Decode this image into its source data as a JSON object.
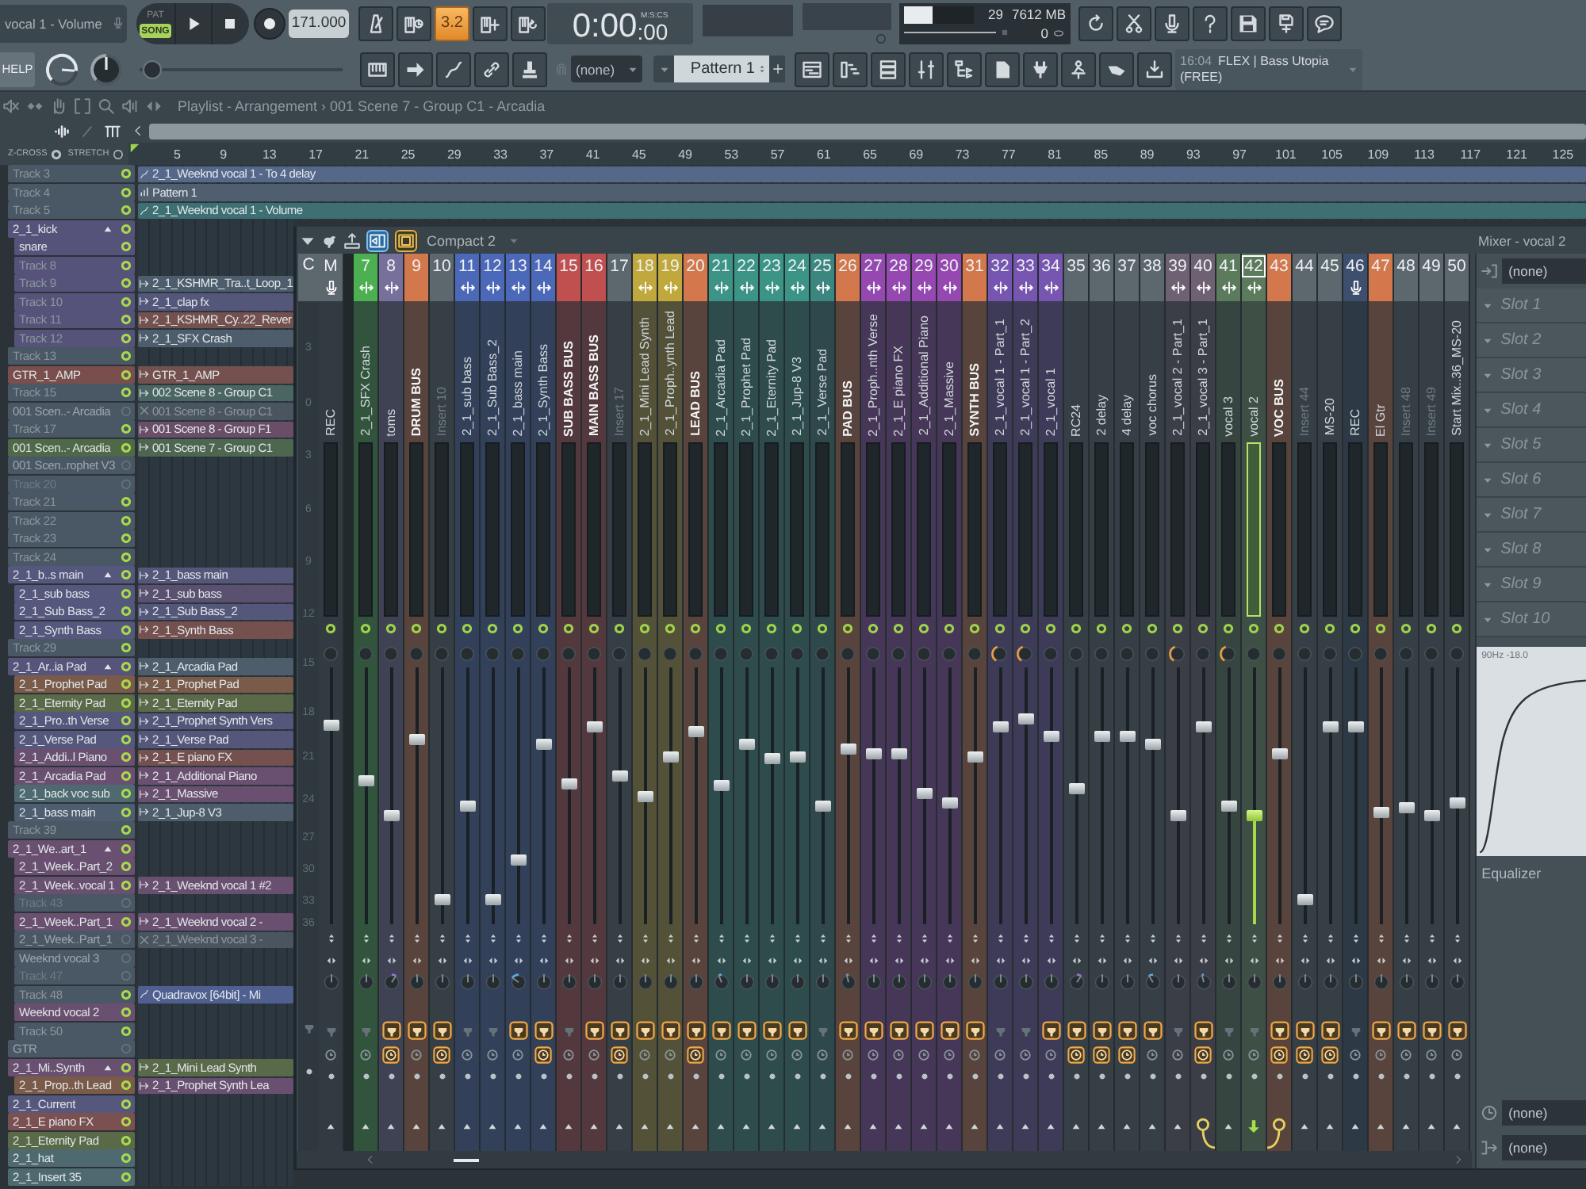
{
  "toolbar": {
    "hint": "vocal 1 - Volume",
    "modes": [
      {
        "label": "PAT",
        "selected": false
      },
      {
        "label": "SONG",
        "selected": true
      }
    ],
    "tempo": "171.000",
    "countdown": {
      "label": "3.2",
      "on": true
    },
    "time": {
      "main": "0:00",
      "fraction": ":00",
      "unit": "M:S:CS"
    },
    "cpu": {
      "level": 0.4,
      "reading": "29"
    },
    "memory": "7612 MB",
    "polyphony": "0",
    "help": "HELP",
    "knobs": [
      {
        "level": 0.85
      },
      {
        "level": 0.5
      }
    ],
    "slider": {
      "level": 0.02
    },
    "snap": "(none)",
    "pattern": "Pattern 1",
    "news": {
      "time": "16:04",
      "title": "FLEX | Bass Utopia",
      "note": "(FREE)"
    }
  },
  "playlist": {
    "title": "Playlist - Arrangement › 001 Scene 7 - Group C1 - Arcadia",
    "options": [
      {
        "label": "Z-CROSS",
        "on": true
      },
      {
        "label": "STRETCH",
        "on": false
      }
    ],
    "ruler": [
      "5",
      "9",
      "13",
      "17",
      "21",
      "25",
      "29",
      "33",
      "37",
      "41",
      "45",
      "49",
      "53",
      "57",
      "61",
      "65",
      "69",
      "73",
      "77",
      "81",
      "85",
      "89",
      "93",
      "97",
      "101",
      "105",
      "109",
      "113",
      "117",
      "121",
      "125"
    ],
    "tracks": [
      {
        "name": "Track 3",
        "color": "#4a5764",
        "default_name": true,
        "enabled": true,
        "clip": {
          "label": "2_1_Weeknd vocal 1 - To 4 delay",
          "kind": "automation",
          "color": "#56688a",
          "muted": false
        }
      },
      {
        "name": "Track 4",
        "color": "#4a5764",
        "default_name": true,
        "enabled": true,
        "clip": {
          "label": "Pattern 1",
          "kind": "pattern",
          "color": "#505f70",
          "muted": false
        }
      },
      {
        "name": "Track 5",
        "color": "#4a5764",
        "default_name": true,
        "enabled": true,
        "clip": {
          "label": "2_1_Weeknd vocal 1 - Volume",
          "kind": "automation",
          "color": "#3d6f73",
          "muted": false
        }
      },
      {
        "name": "2_1_kick",
        "color": "#56537a",
        "default_name": false,
        "enabled": true,
        "expanded": true,
        "children": [
          {
            "name": "snare",
            "color": "#56537a",
            "default_name": false,
            "enabled": true
          },
          {
            "name": "Track 8",
            "color": "#56537a",
            "default_name": true,
            "enabled": true
          },
          {
            "name": "Track 9",
            "color": "#56537a",
            "default_name": true,
            "enabled": true,
            "clip": {
              "label": "2_1_KSHMR_Tra..t_Loop_1",
              "kind": "audio",
              "color": "#4d5d6c",
              "muted": false
            }
          },
          {
            "name": "Track 10",
            "color": "#56537a",
            "default_name": true,
            "enabled": true,
            "clip": {
              "label": "2_1_clap fx",
              "kind": "audio",
              "color": "#55577a",
              "muted": false
            }
          },
          {
            "name": "Track 11",
            "color": "#56537a",
            "default_name": true,
            "enabled": true,
            "clip": {
              "label": "2_1_KSHMR_Cy..22_Rever",
              "kind": "audio",
              "color": "#74504e",
              "muted": false
            }
          },
          {
            "name": "Track 12",
            "color": "#56537a",
            "default_name": true,
            "enabled": true,
            "clip": {
              "label": "2_1_SFX Crash",
              "kind": "audio",
              "color": "#4d5d6c",
              "muted": false
            }
          }
        ]
      },
      {
        "name": "Track 13",
        "color": "#4a5764",
        "default_name": true,
        "enabled": true
      },
      {
        "name": "GTR_1_AMP",
        "color": "#7a4e4c",
        "default_name": false,
        "enabled": true,
        "clip": {
          "label": "GTR_1_AMP",
          "kind": "audio",
          "color": "#74504e",
          "muted": false
        }
      },
      {
        "name": "Track 15",
        "color": "#4a5764",
        "default_name": true,
        "enabled": true,
        "clip": {
          "label": "002 Scene 8 - Group C1",
          "kind": "audio",
          "color": "#4b6662",
          "muted": false
        }
      },
      {
        "name": "001 Scen..- Arcadia",
        "color": "#4a5764",
        "default_name": false,
        "enabled": false,
        "clip": {
          "label": "001 Scene 8 - Group C1",
          "color": "#4a5560",
          "muted": true
        }
      },
      {
        "name": "Track 17",
        "color": "#4a5764",
        "default_name": true,
        "enabled": true,
        "clip": {
          "label": "001 Scene 8 - Group F1",
          "kind": "audio",
          "color": "#6a4e68",
          "muted": false
        }
      },
      {
        "name": "001 Scen..- Arcadia",
        "color": "#4e6848",
        "default_name": false,
        "enabled": true,
        "clip": {
          "label": "001 Scene 7 - Group C1",
          "kind": "audio",
          "color": "#4e6650",
          "muted": false
        }
      },
      {
        "name": "001 Scen..rophet V3",
        "color": "#4a5764",
        "default_name": false,
        "enabled": false
      },
      {
        "name": "Track 20",
        "color": "#4a5764",
        "default_name": true,
        "enabled": false
      },
      {
        "name": "Track 21",
        "color": "#4a5764",
        "default_name": true,
        "enabled": true
      },
      {
        "name": "Track 22",
        "color": "#4a5764",
        "default_name": true,
        "enabled": true
      },
      {
        "name": "Track 23",
        "color": "#4a5764",
        "default_name": true,
        "enabled": true
      },
      {
        "name": "Track 24",
        "color": "#4a5764",
        "default_name": true,
        "enabled": true
      },
      {
        "name": "2_1_b..s main",
        "color": "#55577d",
        "default_name": false,
        "enabled": true,
        "expanded": true,
        "clip": {
          "label": "2_1_bass main",
          "kind": "audio",
          "color": "#55577a",
          "muted": false
        },
        "children": [
          {
            "name": "2_1_sub bass",
            "color": "#55577d",
            "default_name": false,
            "enabled": true,
            "clip": {
              "label": "2_1_sub bass",
              "kind": "audio",
              "color": "#5a5070",
              "muted": false
            }
          },
          {
            "name": "2_1_Sub Bass_2",
            "color": "#55577d",
            "default_name": false,
            "enabled": true,
            "clip": {
              "label": "2_1_Sub Bass_2",
              "kind": "audio",
              "color": "#55577a",
              "muted": false
            }
          },
          {
            "name": "2_1_Synth Bass",
            "color": "#55577d",
            "default_name": false,
            "enabled": true,
            "clip": {
              "label": "2_1_Synth Bass",
              "kind": "audio",
              "color": "#74504e",
              "muted": false
            }
          }
        ]
      },
      {
        "name": "Track 29",
        "color": "#4a5764",
        "default_name": true,
        "enabled": true
      },
      {
        "name": "2_1_Ar..ia Pad",
        "color": "#56547a",
        "default_name": false,
        "enabled": true,
        "expanded": true,
        "clip": {
          "label": "2_1_Arcadia Pad",
          "kind": "audio",
          "color": "#4d5d6c",
          "muted": false
        },
        "children": [
          {
            "name": "2_1_Prophet Pad",
            "color": "#7a5a48",
            "default_name": false,
            "enabled": true,
            "clip": {
              "label": "2_1_Prophet Pad",
              "kind": "audio",
              "color": "#7a5a48",
              "muted": false
            }
          },
          {
            "name": "2_1_Eternity Pad",
            "color": "#5a6a48",
            "default_name": false,
            "enabled": true,
            "clip": {
              "label": "2_1_Eternity Pad",
              "kind": "audio",
              "color": "#5a6a48",
              "muted": false
            }
          },
          {
            "name": "2_1_Pro..th Verse",
            "color": "#55577d",
            "default_name": false,
            "enabled": true,
            "clip": {
              "label": "2_1_Prophet Synth Vers",
              "kind": "audio",
              "color": "#55577a",
              "muted": false
            }
          },
          {
            "name": "2_1_Verse Pad",
            "color": "#55577d",
            "default_name": false,
            "enabled": true,
            "clip": {
              "label": "2_1_Verse Pad",
              "kind": "audio",
              "color": "#55577a",
              "muted": false
            }
          },
          {
            "name": "2_1_Addi..l Piano",
            "color": "#6a5070",
            "default_name": false,
            "enabled": true,
            "clip": {
              "label": "2_1_E piano FX",
              "kind": "audio",
              "color": "#74504e",
              "muted": false
            }
          },
          {
            "name": "2_1_Arcadia Pad",
            "color": "#6a5070",
            "default_name": false,
            "enabled": true,
            "clip": {
              "label": "2_1_Additional Piano",
              "kind": "audio",
              "color": "#6a5070",
              "muted": false
            }
          },
          {
            "name": "2_1_back voc sub",
            "color": "#4e6a70",
            "default_name": false,
            "enabled": true,
            "clip": {
              "label": "2_1_Massive",
              "kind": "audio",
              "color": "#6a5070",
              "muted": false
            }
          },
          {
            "name": "2_1_bass main",
            "color": "#4e5e70",
            "default_name": false,
            "enabled": true,
            "clip": {
              "label": "2_1_Jup-8 V3",
              "kind": "audio",
              "color": "#4d5d6c",
              "muted": false
            }
          }
        ]
      },
      {
        "name": "Track 39",
        "color": "#4a5764",
        "default_name": true,
        "enabled": true
      },
      {
        "name": "2_1_We..art_1",
        "color": "#6a5070",
        "default_name": false,
        "enabled": true,
        "expanded": true,
        "children": [
          {
            "name": "2_1_Week..Part_2",
            "color": "#6a5070",
            "default_name": false,
            "enabled": true
          },
          {
            "name": "2_1_Week..vocal 1",
            "color": "#6a5070",
            "default_name": false,
            "enabled": true,
            "clip": {
              "label": "2_1_Weeknd vocal 1 #2",
              "kind": "audio",
              "color": "#6a5070",
              "muted": false
            }
          },
          {
            "name": "Track 43",
            "color": "#4a5764",
            "default_name": true,
            "enabled": false
          },
          {
            "name": "2_1_Week..Part_1",
            "color": "#6a5070",
            "default_name": false,
            "enabled": true,
            "clip": {
              "label": "2_1_Weeknd vocal 2 -",
              "kind": "audio",
              "color": "#6a5070",
              "muted": false
            }
          },
          {
            "name": "2_1_Week..Part_1",
            "color": "#4a5764",
            "default_name": false,
            "enabled": false,
            "clip": {
              "label": "2_1_Weeknd vocal 3 -",
              "color": "#4a5560",
              "muted": true
            }
          },
          {
            "name": "Weeknd vocal 3",
            "color": "#4a5764",
            "default_name": false,
            "enabled": false
          },
          {
            "name": "Track 47",
            "color": "#4a5764",
            "default_name": true,
            "enabled": false
          },
          {
            "name": "Track 48",
            "color": "#4a5764",
            "default_name": true,
            "enabled": true,
            "clip": {
              "label": "Quadravox [64bit] - Mi",
              "kind": "automation",
              "color": "#4f6090",
              "muted": false
            }
          },
          {
            "name": "Weeknd vocal 2",
            "color": "#6a5070",
            "default_name": false,
            "enabled": true
          },
          {
            "name": "Track 50",
            "color": "#4a5764",
            "default_name": true,
            "enabled": true
          }
        ]
      },
      {
        "name": "GTR",
        "color": "#4a5764",
        "default_name": false,
        "enabled": false
      },
      {
        "name": "2_1_Mi..Synth",
        "color": "#6a5070",
        "default_name": false,
        "enabled": true,
        "expanded": true,
        "clip": {
          "label": "2_1_Mini Lead Synth",
          "kind": "audio",
          "color": "#5a6a48",
          "muted": false
        },
        "children": [
          {
            "name": "2_1_Prop..th Lead",
            "color": "#7a5a48",
            "default_name": false,
            "enabled": true,
            "clip": {
              "label": "2_1_Prophet Synth Lea",
              "kind": "audio",
              "color": "#6a5070",
              "muted": false
            }
          }
        ]
      },
      {
        "name": "2_1_Current",
        "color": "#55577d",
        "default_name": false,
        "enabled": true
      },
      {
        "name": "2_1_E piano FX",
        "color": "#7a5050",
        "default_name": false,
        "enabled": true
      },
      {
        "name": "2_1_Eternity Pad",
        "color": "#5a6a48",
        "default_name": false,
        "enabled": true
      },
      {
        "name": "2_1_hat",
        "color": "#4e6a70",
        "default_name": false,
        "enabled": true
      },
      {
        "name": "2_1_Insert 35",
        "color": "#4e6a70",
        "default_name": false,
        "enabled": true
      }
    ]
  },
  "mixer": {
    "title": "Mixer - vocal 2",
    "layout": "Compact 2",
    "current": {
      "label": "C",
      "scale": [
        "3",
        "0",
        "3",
        "6",
        "9",
        "12",
        "15",
        "18",
        "21",
        "24",
        "27",
        "30",
        "33",
        "36"
      ]
    },
    "master": {
      "label": "M",
      "name": "REC",
      "recording": true,
      "level": 0.79,
      "pan": {
        "level": 0.5
      },
      "fx_loaded": false,
      "fx_enabled": false
    },
    "inserts": [
      {
        "number": "7",
        "name": "2_1_SFX Crash",
        "color": "#4caf50",
        "kind": "channel",
        "linked": true,
        "recording": false,
        "level": 0.56,
        "pan": {
          "level": 0.5
        },
        "send": false,
        "fx_loaded": false,
        "fx_enabled": false,
        "selected": false,
        "sends_to_selected": false
      },
      {
        "number": "8",
        "name": "toms",
        "color": "#76709a",
        "kind": "channel",
        "linked": true,
        "recording": false,
        "level": 0.42,
        "pan": {
          "level": 0.62
        },
        "send": false,
        "fx_loaded": true,
        "fx_enabled": true,
        "selected": false,
        "sends_to_selected": false
      },
      {
        "number": "9",
        "name": "DRUM BUS",
        "color": "#d2784c",
        "kind": "bus",
        "linked": false,
        "recording": false,
        "level": 0.73,
        "pan": {
          "level": 0.5
        },
        "send": false,
        "fx_loaded": true,
        "fx_enabled": false,
        "selected": false,
        "sends_to_selected": false
      },
      {
        "number": "10",
        "name": "Insert 10",
        "color": "#5d676e",
        "kind": "empty",
        "linked": false,
        "recording": false,
        "level": 0.08,
        "pan": {
          "level": 0.5
        },
        "send": false,
        "fx_loaded": true,
        "fx_enabled": true,
        "selected": false,
        "sends_to_selected": false
      },
      {
        "number": "11",
        "name": "2_1_sub bass",
        "color": "#4c68b8",
        "kind": "channel",
        "linked": true,
        "recording": false,
        "level": 0.46,
        "pan": {
          "level": 0.5
        },
        "send": false,
        "fx_loaded": false,
        "fx_enabled": false,
        "selected": false,
        "sends_to_selected": false
      },
      {
        "number": "12",
        "name": "2_1_Sub Bass_2",
        "color": "#4c68b8",
        "kind": "channel",
        "linked": true,
        "recording": false,
        "level": 0.08,
        "pan": {
          "level": 0.5
        },
        "send": false,
        "fx_loaded": false,
        "fx_enabled": false,
        "selected": false,
        "sends_to_selected": false
      },
      {
        "number": "13",
        "name": "2_1_bass main",
        "color": "#4c68b8",
        "kind": "channel",
        "linked": true,
        "recording": false,
        "level": 0.24,
        "pan": {
          "level": 0.3
        },
        "send": false,
        "fx_loaded": true,
        "fx_enabled": false,
        "selected": false,
        "sends_to_selected": false
      },
      {
        "number": "14",
        "name": "2_1_Synth Bass",
        "color": "#4c68b8",
        "kind": "channel",
        "linked": true,
        "recording": false,
        "level": 0.71,
        "pan": {
          "level": 0.5
        },
        "send": false,
        "fx_loaded": true,
        "fx_enabled": true,
        "selected": false,
        "sends_to_selected": false
      },
      {
        "number": "15",
        "name": "SUB BASS BUS",
        "color": "#c05050",
        "kind": "bus",
        "linked": false,
        "recording": false,
        "level": 0.55,
        "pan": {
          "level": 0.5
        },
        "send": false,
        "fx_loaded": false,
        "fx_enabled": false,
        "selected": false,
        "sends_to_selected": false
      },
      {
        "number": "16",
        "name": "MAIN BASS BUS",
        "color": "#c05050",
        "kind": "bus",
        "linked": false,
        "recording": false,
        "level": 0.78,
        "pan": {
          "level": 0.5
        },
        "send": false,
        "fx_loaded": true,
        "fx_enabled": false,
        "selected": false,
        "sends_to_selected": false
      },
      {
        "number": "17",
        "name": "Insert 17",
        "color": "#5d676e",
        "kind": "empty",
        "linked": false,
        "recording": false,
        "level": 0.58,
        "pan": {
          "level": 0.5
        },
        "send": false,
        "fx_loaded": true,
        "fx_enabled": true,
        "selected": false,
        "sends_to_selected": false
      },
      {
        "number": "18",
        "name": "2_1_Mini Lead Synth",
        "color": "#c0a83c",
        "kind": "channel",
        "linked": true,
        "recording": false,
        "level": 0.5,
        "pan": {
          "level": 0.5
        },
        "send": false,
        "fx_loaded": true,
        "fx_enabled": false,
        "selected": false,
        "sends_to_selected": false
      },
      {
        "number": "19",
        "name": "2_1_Proph..ynth Lead",
        "color": "#c0a83c",
        "kind": "channel",
        "linked": true,
        "recording": false,
        "level": 0.66,
        "pan": {
          "level": 0.5
        },
        "send": false,
        "fx_loaded": true,
        "fx_enabled": false,
        "selected": false,
        "sends_to_selected": false
      },
      {
        "number": "20",
        "name": "LEAD BUS",
        "color": "#d2784c",
        "kind": "bus",
        "linked": false,
        "recording": false,
        "level": 0.76,
        "pan": {
          "level": 0.5
        },
        "send": false,
        "fx_loaded": true,
        "fx_enabled": true,
        "selected": false,
        "sends_to_selected": false
      },
      {
        "number": "21",
        "name": "2_1_Arcadia Pad",
        "color": "#3c9486",
        "kind": "channel",
        "linked": true,
        "recording": false,
        "level": 0.54,
        "pan": {
          "level": 0.42
        },
        "send": false,
        "fx_loaded": true,
        "fx_enabled": false,
        "selected": false,
        "sends_to_selected": false
      },
      {
        "number": "22",
        "name": "2_1_Prophet Pad",
        "color": "#3c9486",
        "kind": "channel",
        "linked": true,
        "recording": false,
        "level": 0.71,
        "pan": {
          "level": 0.5
        },
        "send": false,
        "fx_loaded": true,
        "fx_enabled": false,
        "selected": false,
        "sends_to_selected": false
      },
      {
        "number": "23",
        "name": "2_1_Eternity Pad",
        "color": "#3c9486",
        "kind": "channel",
        "linked": true,
        "recording": false,
        "level": 0.65,
        "pan": {
          "level": 0.5
        },
        "send": false,
        "fx_loaded": true,
        "fx_enabled": false,
        "selected": false,
        "sends_to_selected": false
      },
      {
        "number": "24",
        "name": "2_1_Jup-8 V3",
        "color": "#3c9486",
        "kind": "channel",
        "linked": true,
        "recording": false,
        "level": 0.66,
        "pan": {
          "level": 0.5
        },
        "send": false,
        "fx_loaded": true,
        "fx_enabled": false,
        "selected": false,
        "sends_to_selected": false
      },
      {
        "number": "25",
        "name": "2_1_Verse Pad",
        "color": "#3c8680",
        "kind": "channel",
        "linked": true,
        "recording": false,
        "level": 0.46,
        "pan": {
          "level": 0.5
        },
        "send": false,
        "fx_loaded": false,
        "fx_enabled": false,
        "selected": false,
        "sends_to_selected": false
      },
      {
        "number": "26",
        "name": "PAD BUS",
        "color": "#d2784c",
        "kind": "bus",
        "linked": false,
        "recording": false,
        "level": 0.69,
        "pan": {
          "level": 0.45
        },
        "send": false,
        "fx_loaded": true,
        "fx_enabled": false,
        "selected": false,
        "sends_to_selected": false
      },
      {
        "number": "27",
        "name": "2_1_Proph..nth Verse",
        "color": "#9448b0",
        "kind": "channel",
        "linked": true,
        "recording": false,
        "level": 0.67,
        "pan": {
          "level": 0.5
        },
        "send": false,
        "fx_loaded": true,
        "fx_enabled": false,
        "selected": false,
        "sends_to_selected": false
      },
      {
        "number": "28",
        "name": "2_1_E piano FX",
        "color": "#9448b0",
        "kind": "channel",
        "linked": true,
        "recording": false,
        "level": 0.67,
        "pan": {
          "level": 0.5
        },
        "send": false,
        "fx_loaded": true,
        "fx_enabled": false,
        "selected": false,
        "sends_to_selected": false
      },
      {
        "number": "29",
        "name": "2_1_Additional Piano",
        "color": "#9448b0",
        "kind": "channel",
        "linked": true,
        "recording": false,
        "level": 0.51,
        "pan": {
          "level": 0.5
        },
        "send": false,
        "fx_loaded": true,
        "fx_enabled": false,
        "selected": false,
        "sends_to_selected": false
      },
      {
        "number": "30",
        "name": "2_1_Massive",
        "color": "#9448b0",
        "kind": "channel",
        "linked": true,
        "recording": false,
        "level": 0.47,
        "pan": {
          "level": 0.5
        },
        "send": false,
        "fx_loaded": true,
        "fx_enabled": false,
        "selected": false,
        "sends_to_selected": false
      },
      {
        "number": "31",
        "name": "SYNTH BUS",
        "color": "#d2784c",
        "kind": "bus",
        "linked": false,
        "recording": false,
        "level": 0.66,
        "pan": {
          "level": 0.5
        },
        "send": false,
        "fx_loaded": true,
        "fx_enabled": false,
        "selected": false,
        "sends_to_selected": false
      },
      {
        "number": "32",
        "name": "2_1_vocal 1 - Part_1",
        "color": "#7656b0",
        "kind": "channel",
        "linked": true,
        "recording": false,
        "level": 0.78,
        "pan": {
          "level": 0.5
        },
        "send": true,
        "fx_loaded": false,
        "fx_enabled": false,
        "selected": false,
        "sends_to_selected": false
      },
      {
        "number": "33",
        "name": "2_1_vocal 1 - Part_2",
        "color": "#7656b0",
        "kind": "channel",
        "linked": true,
        "recording": false,
        "level": 0.81,
        "pan": {
          "level": 0.5
        },
        "send": true,
        "fx_loaded": false,
        "fx_enabled": false,
        "selected": false,
        "sends_to_selected": false
      },
      {
        "number": "34",
        "name": "2_1_vocal 1",
        "color": "#7656b0",
        "kind": "channel",
        "linked": true,
        "recording": false,
        "level": 0.74,
        "pan": {
          "level": 0.5
        },
        "send": false,
        "fx_loaded": true,
        "fx_enabled": false,
        "selected": false,
        "sends_to_selected": false
      },
      {
        "number": "35",
        "name": "RC24",
        "color": "#5d676e",
        "kind": "channel",
        "linked": false,
        "recording": false,
        "level": 0.53,
        "pan": {
          "level": 0.62
        },
        "send": false,
        "fx_loaded": true,
        "fx_enabled": true,
        "selected": false,
        "sends_to_selected": false
      },
      {
        "number": "36",
        "name": "2 delay",
        "color": "#5d676e",
        "kind": "channel",
        "linked": false,
        "recording": false,
        "level": 0.74,
        "pan": {
          "level": 0.5
        },
        "send": false,
        "fx_loaded": true,
        "fx_enabled": true,
        "selected": false,
        "sends_to_selected": false
      },
      {
        "number": "37",
        "name": "4 delay",
        "color": "#5d676e",
        "kind": "channel",
        "linked": false,
        "recording": false,
        "level": 0.74,
        "pan": {
          "level": 0.5
        },
        "send": false,
        "fx_loaded": true,
        "fx_enabled": true,
        "selected": false,
        "sends_to_selected": false
      },
      {
        "number": "38",
        "name": "voc chorus",
        "color": "#5d676e",
        "kind": "channel",
        "linked": false,
        "recording": false,
        "level": 0.71,
        "pan": {
          "level": 0.38
        },
        "send": false,
        "fx_loaded": true,
        "fx_enabled": false,
        "selected": false,
        "sends_to_selected": false
      },
      {
        "number": "39",
        "name": "2_1_vocal 2 - Part_1",
        "color": "#6e6272",
        "kind": "channel",
        "linked": true,
        "recording": false,
        "level": 0.42,
        "pan": {
          "level": 0.5
        },
        "send": true,
        "fx_loaded": false,
        "fx_enabled": false,
        "selected": false,
        "sends_to_selected": false
      },
      {
        "number": "40",
        "name": "2_1_vocal 3 - Part_1",
        "color": "#6e6272",
        "kind": "channel",
        "linked": true,
        "recording": false,
        "level": 0.78,
        "pan": {
          "level": 0.45
        },
        "send": false,
        "fx_loaded": true,
        "fx_enabled": true,
        "selected": false,
        "sends_to_selected": true
      },
      {
        "number": "41",
        "name": "vocal 3",
        "color": "#5c7a5c",
        "kind": "channel",
        "linked": true,
        "recording": false,
        "level": 0.46,
        "pan": {
          "level": 0.5
        },
        "send": true,
        "fx_loaded": false,
        "fx_enabled": false,
        "selected": false,
        "sends_to_selected": false
      },
      {
        "number": "42",
        "name": "vocal 2",
        "color": "#5c7a5c",
        "kind": "channel",
        "linked": true,
        "recording": false,
        "level": 0.42,
        "pan": {
          "level": 0.5
        },
        "send": false,
        "fx_loaded": false,
        "fx_enabled": false,
        "selected": true,
        "sends_to_selected": false
      },
      {
        "number": "43",
        "name": "VOC BUS",
        "color": "#d2784c",
        "kind": "bus",
        "linked": false,
        "recording": false,
        "level": 0.67,
        "pan": {
          "level": 0.5
        },
        "send": false,
        "fx_loaded": true,
        "fx_enabled": true,
        "selected": false,
        "sends_to_selected": true
      },
      {
        "number": "44",
        "name": "Insert 44",
        "color": "#5d676e",
        "kind": "empty",
        "linked": false,
        "recording": false,
        "level": 0.08,
        "pan": {
          "level": 0.5
        },
        "send": false,
        "fx_loaded": true,
        "fx_enabled": true,
        "selected": false,
        "sends_to_selected": false
      },
      {
        "number": "45",
        "name": "MS-20",
        "color": "#5d676e",
        "kind": "channel",
        "linked": false,
        "recording": false,
        "level": 0.78,
        "pan": {
          "level": 0.5
        },
        "send": false,
        "fx_loaded": true,
        "fx_enabled": true,
        "selected": false,
        "sends_to_selected": false
      },
      {
        "number": "46",
        "name": "REC",
        "color": "#3e4f6e",
        "kind": "channel",
        "linked": false,
        "recording": true,
        "level": 0.78,
        "pan": {
          "level": 0.5
        },
        "send": false,
        "fx_loaded": false,
        "fx_enabled": false,
        "selected": false,
        "sends_to_selected": false
      },
      {
        "number": "47",
        "name": "El Gtr",
        "color": "#d2784c",
        "kind": "channel",
        "linked": false,
        "recording": false,
        "level": 0.43,
        "pan": {
          "level": 0.5
        },
        "send": false,
        "fx_loaded": true,
        "fx_enabled": false,
        "selected": false,
        "sends_to_selected": false
      },
      {
        "number": "48",
        "name": "Insert 48",
        "color": "#5d676e",
        "kind": "empty",
        "linked": false,
        "recording": false,
        "level": 0.45,
        "pan": {
          "level": 0.5
        },
        "send": false,
        "fx_loaded": true,
        "fx_enabled": false,
        "selected": false,
        "sends_to_selected": false
      },
      {
        "number": "49",
        "name": "Insert 49",
        "color": "#5d676e",
        "kind": "empty",
        "linked": false,
        "recording": false,
        "level": 0.42,
        "pan": {
          "level": 0.5
        },
        "send": false,
        "fx_loaded": true,
        "fx_enabled": false,
        "selected": false,
        "sends_to_selected": false
      },
      {
        "number": "50",
        "name": "Start Mix..36_MS-20",
        "color": "#5d676e",
        "kind": "channel",
        "linked": false,
        "recording": false,
        "level": 0.47,
        "pan": {
          "level": 0.5
        },
        "send": false,
        "fx_loaded": true,
        "fx_enabled": false,
        "selected": false,
        "sends_to_selected": false
      }
    ],
    "input": "(none)",
    "slots": [
      "Slot 1",
      "Slot 2",
      "Slot 3",
      "Slot 4",
      "Slot 5",
      "Slot 6",
      "Slot 7",
      "Slot 8",
      "Slot 9",
      "Slot 10"
    ],
    "eq": {
      "reading": "90Hz -18.0",
      "label": "Equalizer"
    },
    "outputs": [
      "(none)",
      "(none)"
    ]
  }
}
